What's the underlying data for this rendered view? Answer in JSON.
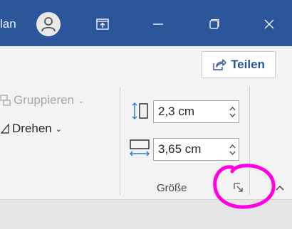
{
  "titlebar": {
    "user_name": "lan",
    "bg_color": "#2b579a"
  },
  "ribbon": {
    "share_label": "Teilen",
    "group_label": "Gruppieren",
    "rotate_label": "Drehen",
    "size_group": {
      "label": "Größe",
      "height_value": "2,3 cm",
      "width_value": "3,65 cm"
    }
  },
  "annotation": {
    "color": "#ff00e6",
    "shape": "hand-drawn circle around dialog launcher"
  }
}
